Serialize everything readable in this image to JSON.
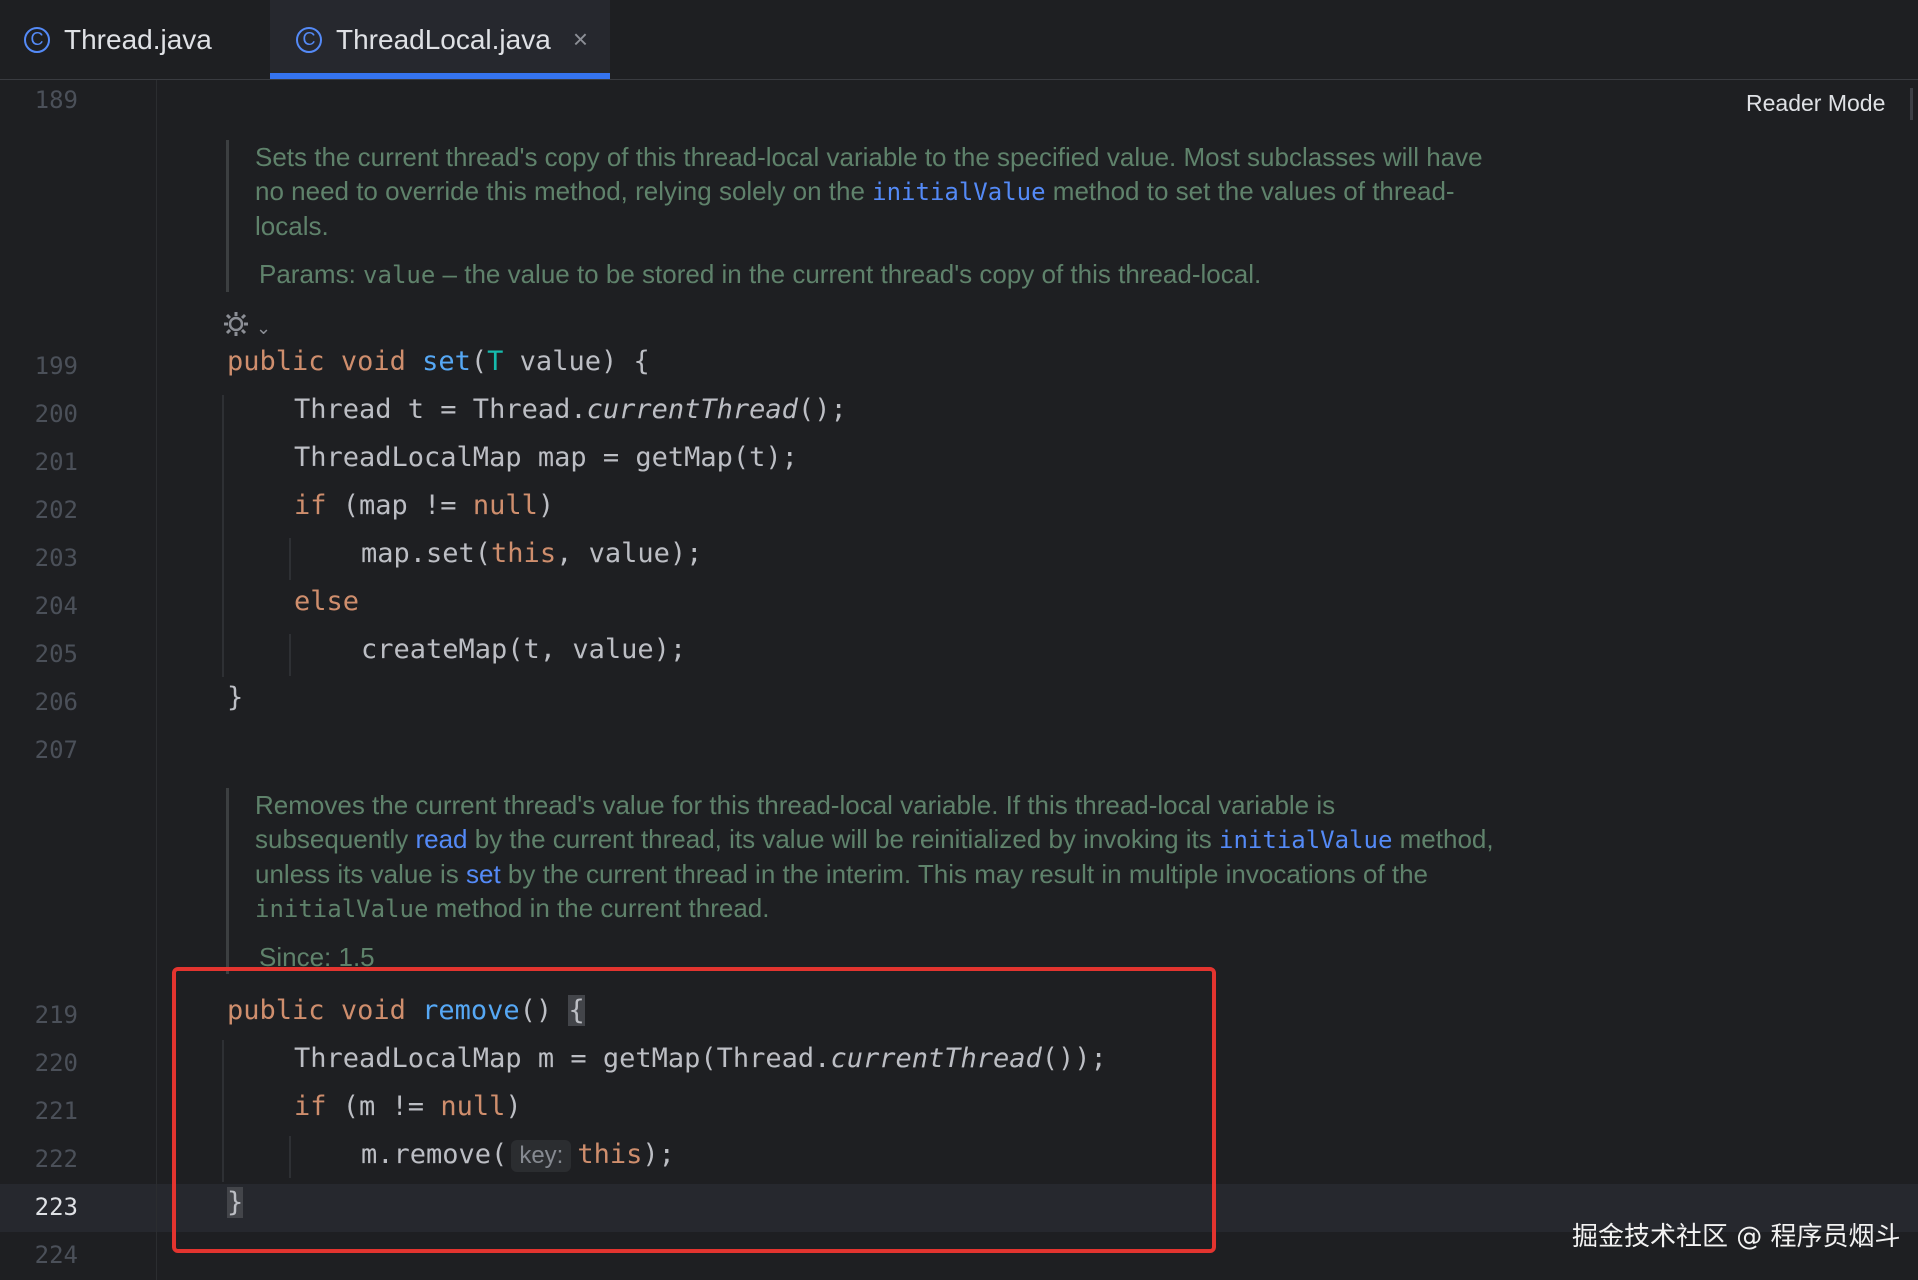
{
  "tabs": [
    {
      "label": "Thread.java",
      "icon": "class-icon"
    },
    {
      "label": "ThreadLocal.java",
      "icon": "class-icon",
      "active": true,
      "close": "×"
    }
  ],
  "reader_mode": "Reader Mode",
  "line_numbers": [
    "189",
    "199",
    "200",
    "201",
    "202",
    "203",
    "204",
    "205",
    "206",
    "207",
    "219",
    "220",
    "221",
    "222",
    "223",
    "224"
  ],
  "doc1": {
    "text1": "Sets the current thread's copy of this thread-local variable to the specified value. Most subclasses will have no need to override this method, relying solely on the",
    "link": "initialValue",
    "text2": "method to set the values of thread-locals.",
    "params_label": "Params:",
    "params_name": "value",
    "params_text": "– the value to be stored in the current thread's copy of this thread-local."
  },
  "doc2": {
    "text1": "Removes the current thread's value for this thread-local variable. If this thread-local variable is subsequently",
    "link_read": "read",
    "text2": "by the current thread, its value will be reinitialized by invoking its",
    "link_initial": "initialValue",
    "text3": "method, unless its value is",
    "link_set": "set",
    "text4": "by the current thread in the interim. This may result in multiple invocations of the",
    "mono": "initialValue",
    "text5": "method in the current thread.",
    "since": "Since: 1.5"
  },
  "code_set": {
    "l199": {
      "kw1": "public",
      "kw2": "void",
      "fn": "set",
      "p1": "(",
      "type": "T",
      "p2": " value) {"
    },
    "l200": {
      "a": "Thread t = Thread.",
      "it": "currentThread",
      "b": "();"
    },
    "l201": "ThreadLocalMap map = getMap(t);",
    "l202": {
      "kw": "if",
      "a": " (map != ",
      "kw2": "null",
      "b": ")"
    },
    "l203": {
      "a": "map.set(",
      "kw": "this",
      "b": ", value);"
    },
    "l204": "else",
    "l205": "createMap(t, value);",
    "l206": "}"
  },
  "code_remove": {
    "l219": {
      "kw1": "public",
      "kw2": "void",
      "fn": "remove",
      "p": "() ",
      "brace": "{"
    },
    "l220": {
      "a": "ThreadLocalMap m = getMap(Thread.",
      "it": "currentThread",
      "b": "());"
    },
    "l221": {
      "kw": "if",
      "a": " (m != ",
      "kw2": "null",
      "b": ")"
    },
    "l222": {
      "a": "m.remove(",
      "hint": "key:",
      "kw": "this",
      "b": ");"
    },
    "l223": "}"
  },
  "watermark": "掘金技术社区 @ 程序员烟斗",
  "colors": {
    "keyword": "#cf8e6d",
    "function": "#56a8f5",
    "doc": "#5f826b",
    "link": "#548af7",
    "annotation_box": "#e3342f"
  }
}
